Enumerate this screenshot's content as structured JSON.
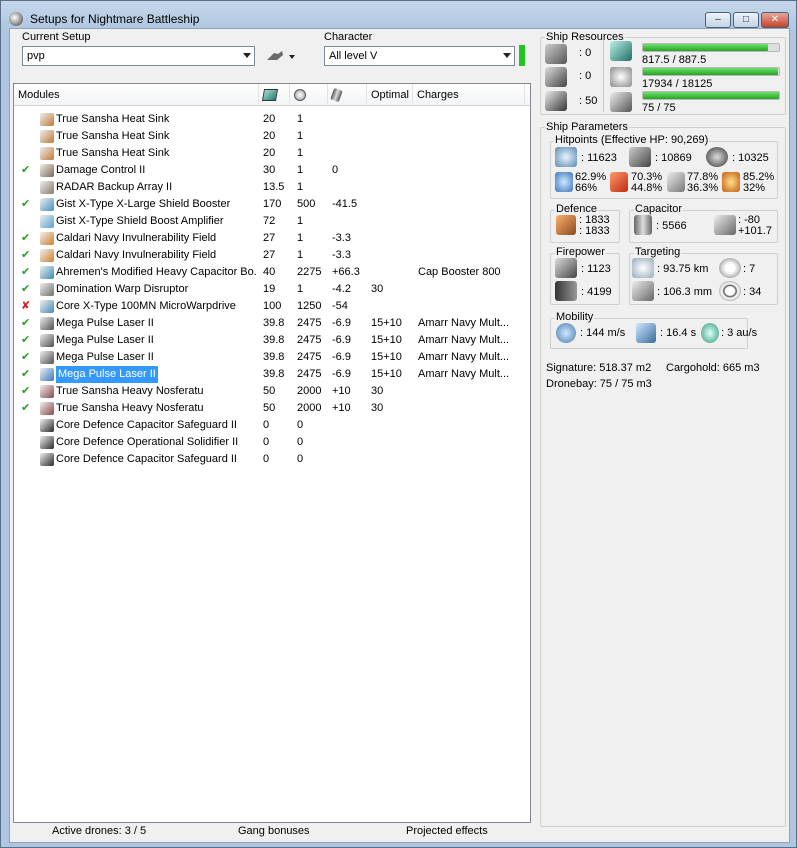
{
  "window": {
    "title": "Setups for Nightmare Battleship",
    "min": "–",
    "max": "□",
    "close": "✕"
  },
  "setup": {
    "label": "Current Setup",
    "value": "pvp"
  },
  "character": {
    "label": "Character",
    "value": "All level V",
    "status_color": "#22c422"
  },
  "modules": {
    "columns": [
      "Modules",
      "",
      "",
      "",
      "Optimal",
      "Charges"
    ],
    "rows": [
      {
        "status": "",
        "name": "True Sansha Heat Sink",
        "cpu": "20",
        "pg": "1",
        "cap": "",
        "optimal": "",
        "charges": "",
        "icon": "heat-sink-icon",
        "color": "#c07a3a"
      },
      {
        "status": "",
        "name": "True Sansha Heat Sink",
        "cpu": "20",
        "pg": "1",
        "cap": "",
        "optimal": "",
        "charges": "",
        "icon": "heat-sink-icon",
        "color": "#c07a3a"
      },
      {
        "status": "",
        "name": "True Sansha Heat Sink",
        "cpu": "20",
        "pg": "1",
        "cap": "",
        "optimal": "",
        "charges": "",
        "icon": "heat-sink-icon",
        "color": "#c07a3a"
      },
      {
        "status": "✔",
        "name": "Damage Control II",
        "cpu": "30",
        "pg": "1",
        "cap": "0",
        "optimal": "",
        "charges": "",
        "icon": "damage-control-icon",
        "color": "#7a6a50"
      },
      {
        "status": "",
        "name": "RADAR Backup Array II",
        "cpu": "13.5",
        "pg": "1",
        "cap": "",
        "optimal": "",
        "charges": "",
        "icon": "backup-array-icon",
        "color": "#8a7a6a"
      },
      {
        "status": "✔",
        "name": "Gist X-Type X-Large Shield Booster",
        "cpu": "170",
        "pg": "500",
        "cap": "-41.5",
        "optimal": "",
        "charges": "",
        "icon": "shield-booster-icon",
        "color": "#4a90c0"
      },
      {
        "status": "",
        "name": "Gist X-Type Shield Boost Amplifier",
        "cpu": "72",
        "pg": "1",
        "cap": "",
        "optimal": "",
        "charges": "",
        "icon": "shield-amplifier-icon",
        "color": "#5aa0d0"
      },
      {
        "status": "✔",
        "name": "Caldari Navy Invulnerability Field",
        "cpu": "27",
        "pg": "1",
        "cap": "-3.3",
        "optimal": "",
        "charges": "",
        "icon": "invulnerability-icon",
        "color": "#d08030"
      },
      {
        "status": "✔",
        "name": "Caldari Navy Invulnerability Field",
        "cpu": "27",
        "pg": "1",
        "cap": "-3.3",
        "optimal": "",
        "charges": "",
        "icon": "invulnerability-icon",
        "color": "#d08030"
      },
      {
        "status": "✔",
        "name": "Ahremen's Modified Heavy Capacitor Bo...",
        "cpu": "40",
        "pg": "2275",
        "cap": "+66.3",
        "optimal": "",
        "charges": "Cap Booster 800",
        "icon": "cap-booster-icon",
        "color": "#3a8ab0"
      },
      {
        "status": "✔",
        "name": "Domination Warp Disruptor",
        "cpu": "19",
        "pg": "1",
        "cap": "-4.2",
        "optimal": "30",
        "charges": "",
        "icon": "warp-disruptor-icon",
        "color": "#707070"
      },
      {
        "status": "✘",
        "name": "Core X-Type 100MN MicroWarpdrive",
        "cpu": "100",
        "pg": "1250",
        "cap": "-54",
        "optimal": "",
        "charges": "",
        "icon": "microwarpdrive-icon",
        "color": "#4a8ab8"
      },
      {
        "status": "✔",
        "name": "Mega Pulse Laser II",
        "cpu": "39.8",
        "pg": "2475",
        "cap": "-6.9",
        "optimal": "15+10",
        "charges": "Amarr Navy Mult...",
        "icon": "laser-icon",
        "color": "#505050"
      },
      {
        "status": "✔",
        "name": "Mega Pulse Laser II",
        "cpu": "39.8",
        "pg": "2475",
        "cap": "-6.9",
        "optimal": "15+10",
        "charges": "Amarr Navy Mult...",
        "icon": "laser-icon",
        "color": "#505050"
      },
      {
        "status": "✔",
        "name": "Mega Pulse Laser II",
        "cpu": "39.8",
        "pg": "2475",
        "cap": "-6.9",
        "optimal": "15+10",
        "charges": "Amarr Navy Mult...",
        "icon": "laser-icon",
        "color": "#505050"
      },
      {
        "status": "✔",
        "name": "Mega Pulse Laser II",
        "cpu": "39.8",
        "pg": "2475",
        "cap": "-6.9",
        "optimal": "15+10",
        "charges": "Amarr Navy Mult...",
        "icon": "laser-icon",
        "color": "#3a7ac0",
        "selected": true
      },
      {
        "status": "✔",
        "name": "True Sansha Heavy Nosferatu",
        "cpu": "50",
        "pg": "2000",
        "cap": "+10",
        "optimal": "30",
        "charges": "",
        "icon": "nosferatu-icon",
        "color": "#8a4a4a"
      },
      {
        "status": "✔",
        "name": "True Sansha Heavy Nosferatu",
        "cpu": "50",
        "pg": "2000",
        "cap": "+10",
        "optimal": "30",
        "charges": "",
        "icon": "nosferatu-icon",
        "color": "#8a4a4a"
      },
      {
        "status": "",
        "name": "Core Defence Capacitor Safeguard II",
        "cpu": "0",
        "pg": "0",
        "cap": "",
        "optimal": "",
        "charges": "",
        "icon": "rig-icon",
        "color": "#2a2a2a"
      },
      {
        "status": "",
        "name": "Core Defence Operational Solidifier II",
        "cpu": "0",
        "pg": "0",
        "cap": "",
        "optimal": "",
        "charges": "",
        "icon": "rig-icon",
        "color": "#2a2a2a"
      },
      {
        "status": "",
        "name": "Core Defence Capacitor Safeguard II",
        "cpu": "0",
        "pg": "0",
        "cap": "",
        "optimal": "",
        "charges": "",
        "icon": "rig-icon",
        "color": "#2a2a2a"
      }
    ]
  },
  "status_bar": {
    "drones": "Active drones: 3 / 5",
    "gang": "Gang bonuses",
    "projected": "Projected effects"
  },
  "resources": {
    "title": "Ship Resources",
    "turrets": ": 0",
    "launchers": ": 0",
    "calibration": ": 50",
    "cpu": "817.5 / 887.5",
    "cpu_fill": 0.921,
    "powergrid": "17934 / 18125",
    "powergrid_fill": 0.989,
    "dronebay": "75 / 75",
    "dronebay_fill": 1.0
  },
  "parameters": {
    "title": "Ship Parameters",
    "hitpoints_title": "Hitpoints (Effective HP: 90,269)",
    "shield_hp": ": 11623",
    "armor_hp": ": 10869",
    "structure_hp": ": 10325",
    "res_em": "62.9%",
    "res_em2": "66%",
    "res_therm": "70.3%",
    "res_therm2": "44.8%",
    "res_kin": "77.8%",
    "res_kin2": "36.3%",
    "res_exp": "85.2%",
    "res_exp2": "32%",
    "defence_title": "Defence",
    "def1": ": 1833",
    "def2": ": 1833",
    "capacitor_title": "Capacitor",
    "cap_amount": ": 5566",
    "cap_a": ": -80",
    "cap_b": "+101.7",
    "firepower_title": "Firepower",
    "dps": ": 1123",
    "volley": ": 4199",
    "targeting_title": "Targeting",
    "range": ": 93.75 km",
    "max_targets": ": 7",
    "scan_res": ": 106.3 mm",
    "sensor": ": 34",
    "mobility_title": "Mobility",
    "speed": ": 144 m/s",
    "align": ": 16.4 s",
    "warp": ": 3 au/s",
    "signature": "Signature: 518.37 m2",
    "cargohold": "Cargohold: 665 m3",
    "dronebay": "Dronebay: 75 / 75 m3"
  }
}
